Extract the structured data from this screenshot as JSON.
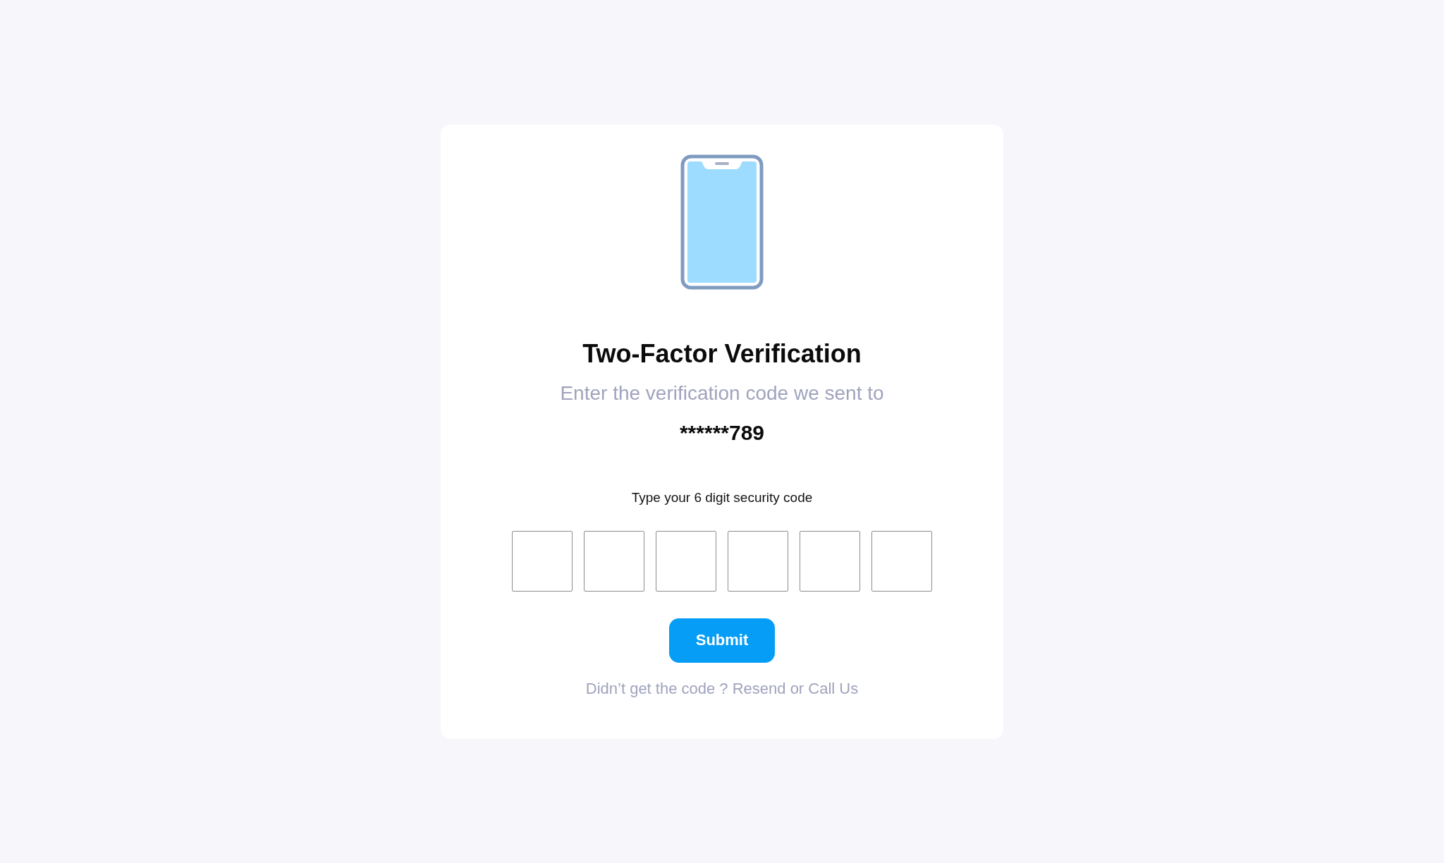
{
  "card": {
    "title": "Two-Factor Verification",
    "subtitle": "Enter the verification code we sent to",
    "masked_phone": "******789",
    "code_label": "Type your 6 digit security code",
    "code_fields": [
      {
        "filled": false
      },
      {
        "filled": false
      },
      {
        "filled": false
      },
      {
        "filled": false
      },
      {
        "filled": false
      },
      {
        "filled": false
      }
    ],
    "submit_button": "Submit",
    "footer": "Didn’t get the code ? Resend or Call Us"
  }
}
